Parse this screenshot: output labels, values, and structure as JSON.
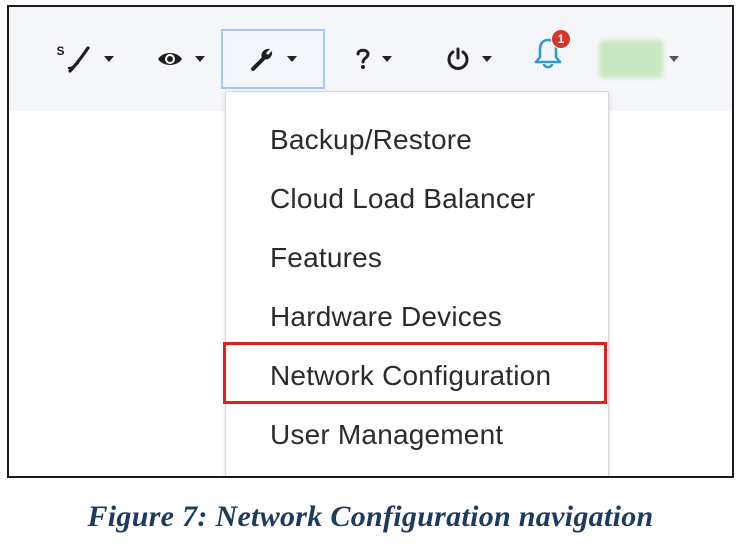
{
  "toolbar": {
    "signature_letter": "S",
    "notification_count": "1"
  },
  "menu": {
    "items": [
      {
        "label": "Backup/Restore"
      },
      {
        "label": "Cloud Load Balancer"
      },
      {
        "label": "Features"
      },
      {
        "label": "Hardware Devices"
      },
      {
        "label": "Network Configuration",
        "highlighted": true
      },
      {
        "label": "User Management"
      }
    ]
  },
  "caption": "Figure 7: Network Configuration navigation",
  "colors": {
    "highlight": "#e02020",
    "badge": "#d9342b",
    "bell": "#2a9bd6",
    "caption": "#1d3a5f",
    "toolbar_bg": "#f5f6fa"
  },
  "icons": [
    "signature-icon",
    "eye-icon",
    "wrench-icon",
    "help-icon",
    "power-icon",
    "bell-icon"
  ]
}
